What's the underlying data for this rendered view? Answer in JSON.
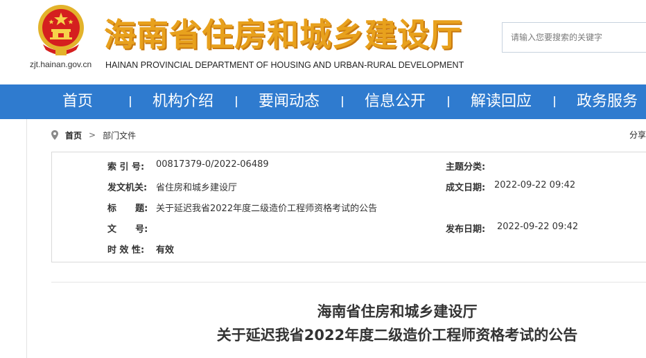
{
  "site": {
    "title": "海南省住房和城乡建设厅",
    "subtitle": "HAINAN PROVINCIAL DEPARTMENT OF HOUSING AND URBAN-RURAL DEVELOPMENT",
    "domain": "zjt.hainan.gov.cn",
    "emblem_icon": "national-emblem-icon",
    "accent_color": "#2f7bcf",
    "title_color": "#e8a11d"
  },
  "search": {
    "placeholder": "请输入您要搜索的关键字"
  },
  "nav": {
    "items": [
      {
        "label": "首页"
      },
      {
        "label": "机构介绍"
      },
      {
        "label": "要闻动态"
      },
      {
        "label": "信息公开"
      },
      {
        "label": "解读回应"
      },
      {
        "label": "政务服务"
      }
    ],
    "separator": "|"
  },
  "breadcrumb": {
    "icon": "location-pin-icon",
    "home": "首页",
    "separator": ">",
    "current": "部门文件"
  },
  "share_label": "分享",
  "meta": {
    "index_label": "索 引 号:",
    "index_value": "00817379-0/2022-06489",
    "topic_label": "主题分类:",
    "topic_value": "",
    "issuer_label": "发文机关:",
    "issuer_value": "省住房和城乡建设厅",
    "created_label": "成文日期:",
    "created_value": "2022-09-22 09:42",
    "title_label": "标      题:",
    "title_value": "关于延迟我省2022年度二级造价工程师资格考试的公告",
    "doc_no_label": "文      号:",
    "doc_no_value": "",
    "published_label": "发布日期:",
    "published_value": "2022-09-22 09:42",
    "validity_label": "时 效 性:",
    "validity_value": "有效"
  },
  "article": {
    "title_line1": "海南省住房和城乡建设厅",
    "title_line2": "关于延迟我省2022年度二级造价工程师资格考试的公告"
  }
}
